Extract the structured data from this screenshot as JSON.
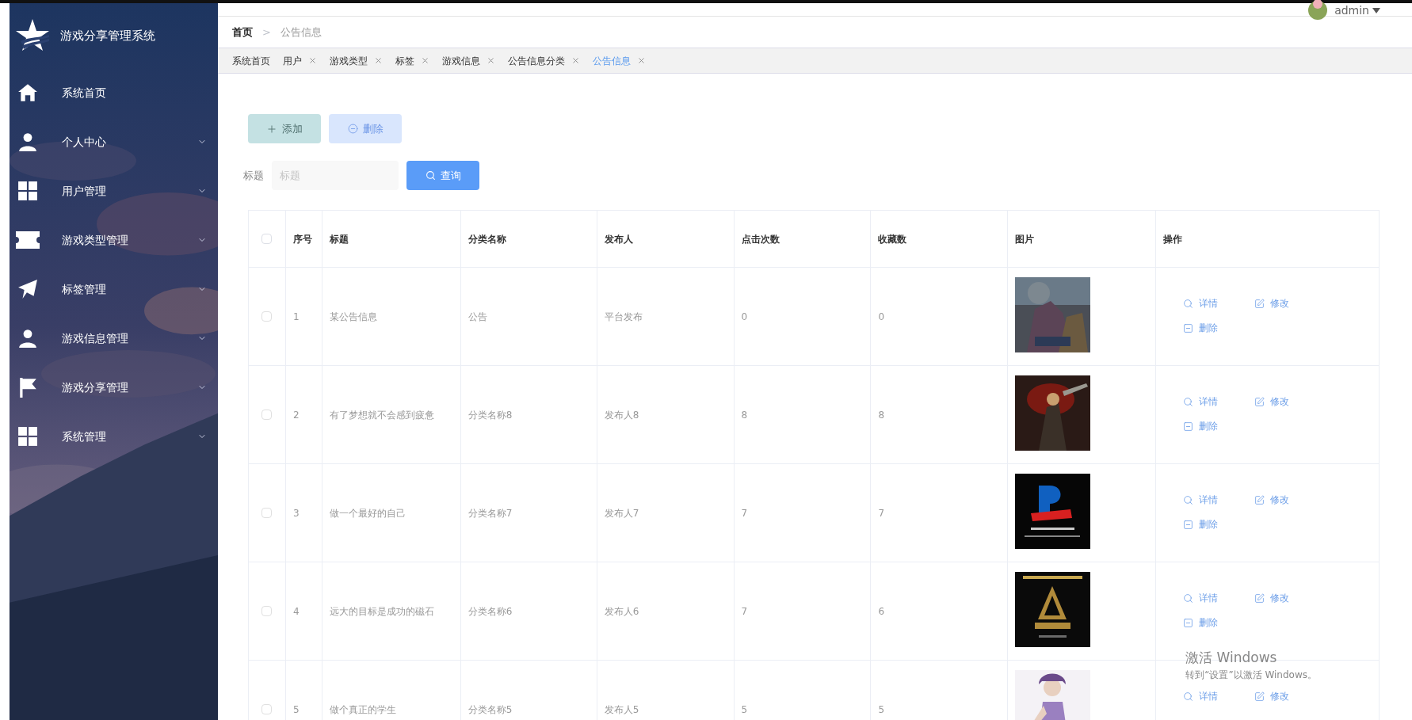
{
  "sidebar": {
    "title": "游戏分享管理系统",
    "items": [
      {
        "label": "系统首页",
        "kind": "home",
        "expandable": false
      },
      {
        "label": "个人中心",
        "kind": "person",
        "expandable": true
      },
      {
        "label": "用户管理",
        "kind": "grid",
        "expandable": true
      },
      {
        "label": "游戏类型管理",
        "kind": "ticket",
        "expandable": true
      },
      {
        "label": "标签管理",
        "kind": "plane",
        "expandable": true
      },
      {
        "label": "游戏信息管理",
        "kind": "person",
        "expandable": true
      },
      {
        "label": "游戏分享管理",
        "kind": "flag",
        "expandable": true
      },
      {
        "label": "系统管理",
        "kind": "grid",
        "expandable": true
      }
    ]
  },
  "header": {
    "user": "admin"
  },
  "breadcrumb": {
    "separator": ">",
    "items": [
      "首页",
      "公告信息"
    ]
  },
  "tabs": [
    {
      "label": "系统首页",
      "closable": false,
      "selected": false
    },
    {
      "label": "用户",
      "closable": true,
      "selected": false
    },
    {
      "label": "游戏类型",
      "closable": true,
      "selected": false
    },
    {
      "label": "标签",
      "closable": true,
      "selected": false
    },
    {
      "label": "游戏信息",
      "closable": true,
      "selected": false
    },
    {
      "label": "公告信息分类",
      "closable": true,
      "selected": false
    },
    {
      "label": "公告信息",
      "closable": true,
      "selected": true
    }
  ],
  "toolbar": [
    {
      "kind": "add",
      "label": "添加"
    },
    {
      "kind": "delete",
      "label": "删除"
    }
  ],
  "search": {
    "label": "标题",
    "placeholder": "标题",
    "button": "查询"
  },
  "table": {
    "header_checked": false,
    "columns": [
      "序号",
      "标题",
      "分类名称",
      "发布人",
      "点击次数",
      "收藏数",
      "图片",
      "操作"
    ],
    "rows": [
      {
        "checked": false,
        "cells": [
          "1",
          "某公告信息",
          "公告",
          "平台发布",
          "0",
          "0"
        ],
        "actions": [
          {
            "kind": "view",
            "label": "详情"
          },
          {
            "kind": "edit",
            "label": "修改"
          },
          {
            "kind": "delete",
            "label": "删除"
          }
        ]
      },
      {
        "checked": false,
        "cells": [
          "2",
          "有了梦想就不会感到疲惫",
          "分类名称8",
          "发布人8",
          "8",
          "8"
        ],
        "actions": [
          {
            "kind": "view",
            "label": "详情"
          },
          {
            "kind": "edit",
            "label": "修改"
          },
          {
            "kind": "delete",
            "label": "删除"
          }
        ]
      },
      {
        "checked": false,
        "cells": [
          "3",
          "做一个最好的自己",
          "分类名称7",
          "发布人7",
          "7",
          "7"
        ],
        "actions": [
          {
            "kind": "view",
            "label": "详情"
          },
          {
            "kind": "edit",
            "label": "修改"
          },
          {
            "kind": "delete",
            "label": "删除"
          }
        ]
      },
      {
        "checked": false,
        "cells": [
          "4",
          "远大的目标是成功的磁石",
          "分类名称6",
          "发布人6",
          "7",
          "6"
        ],
        "actions": [
          {
            "kind": "view",
            "label": "详情"
          },
          {
            "kind": "edit",
            "label": "修改"
          },
          {
            "kind": "delete",
            "label": "删除"
          }
        ]
      },
      {
        "checked": false,
        "cells": [
          "5",
          "做个真正的学生",
          "分类名称5",
          "发布人5",
          "5",
          "5"
        ],
        "actions": [
          {
            "kind": "view",
            "label": "详情"
          },
          {
            "kind": "edit",
            "label": "修改"
          }
        ]
      }
    ]
  },
  "os_notice": [
    "激活 Windows",
    "转到“设置”以激活 Windows。"
  ]
}
